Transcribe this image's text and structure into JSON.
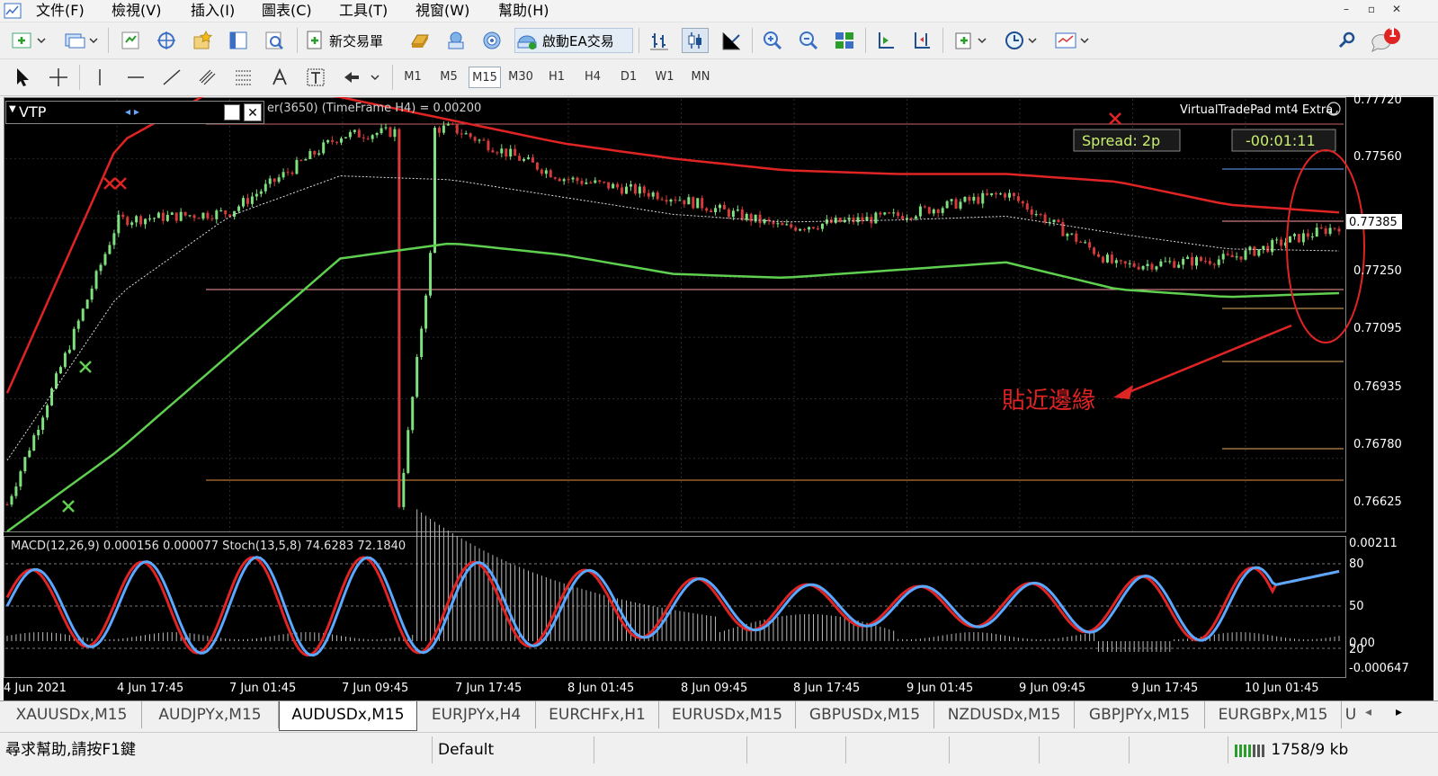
{
  "menu": {
    "file": "文件(F)",
    "view": "檢視(V)",
    "insert": "插入(I)",
    "charts": "圖表(C)",
    "tools": "工具(T)",
    "window": "視窗(W)",
    "help": "幫助(H)"
  },
  "toolbar": {
    "new_order": "新交易單",
    "start_ea": "啟動EA交易"
  },
  "timeframes": [
    "M1",
    "M5",
    "M15",
    "M30",
    "H1",
    "H4",
    "D1",
    "W1",
    "MN"
  ],
  "active_timeframe": "M15",
  "notification_count": "1",
  "vtp_panel": {
    "title": "VTP",
    "nav": "◂ ▸",
    "close": "✕"
  },
  "chart": {
    "indicator_label": "er(3650) (TimeFrame H4) = 0.00200",
    "vtp_brand": "VirtualTradePad mt4 Extra",
    "spread": "Spread: 2p",
    "timer": "-00:01:11",
    "annotation": "貼近邊緣",
    "current_price": "0.77385",
    "price_ticks": [
      "0.77720",
      "0.77560",
      "0.77250",
      "0.77095",
      "0.76935",
      "0.76780",
      "0.76625"
    ],
    "sub_label": "MACD(12,26,9) 0.000156 0.000077  Stoch(13,5,8) 74.6283 72.1840",
    "sub_ticks": [
      "0.00211",
      "80",
      "50",
      "0.00",
      "20",
      "-0.000647"
    ],
    "time_ticks": [
      "4 Jun 2021",
      "4 Jun 17:45",
      "7 Jun 01:45",
      "7 Jun 09:45",
      "7 Jun 17:45",
      "8 Jun 01:45",
      "8 Jun 09:45",
      "8 Jun 17:45",
      "9 Jun 01:45",
      "9 Jun 09:45",
      "9 Jun 17:45",
      "10 Jun 01:45"
    ]
  },
  "chart_tabs": [
    "XAUUSDx,M15",
    "AUDJPYx,M15",
    "AUDUSDx,M15",
    "EURJPYx,H4",
    "EURCHFx,H1",
    "EURUSDx,M15",
    "GBPUSDx,M15",
    "NZDUSDx,M15",
    "GBPJPYx,M15",
    "EURGBPx,M15",
    "U"
  ],
  "active_tab": "AUDUSDx,M15",
  "status": {
    "help": "尋求幫助,請按F1鍵",
    "profile": "Default",
    "traffic": "1758/9 kb"
  },
  "colors": {
    "upper_band": "#e02424",
    "lower_band": "#5fcf4f",
    "bull_candle": "#7ee07e",
    "bear_candle": "#d63b3b",
    "stoch_main": "#5aa8ff",
    "stoch_signal": "#e02424"
  },
  "icons": [
    "new-chart-icon",
    "profiles-icon",
    "market-watch-icon",
    "crosshair-icon",
    "favorites-icon",
    "data-window-icon",
    "strategy-tester-icon",
    "new-order-icon",
    "gold-icon",
    "news-icon",
    "signal-icon",
    "expert-advisor-icon",
    "bar-chart-icon",
    "candle-chart-icon",
    "line-chart-icon",
    "zoom-in-icon",
    "zoom-out-icon",
    "tile-icon",
    "autoscroll-icon",
    "chart-shift-icon",
    "indicators-icon",
    "periods-icon",
    "templates-icon",
    "search-icon",
    "notification-icon"
  ],
  "chart_data": {
    "type": "candlestick",
    "x": [
      "4 Jun 2021",
      "4 Jun 17:45",
      "7 Jun 01:45",
      "7 Jun 09:45",
      "7 Jun 17:45",
      "8 Jun 01:45",
      "8 Jun 09:45",
      "8 Jun 17:45",
      "9 Jun 01:45",
      "9 Jun 09:45",
      "9 Jun 17:45",
      "10 Jun 01:45"
    ],
    "ylim": [
      0.7659,
      0.7772
    ],
    "close": [
      0.7666,
      0.774,
      0.7742,
      0.7762,
      0.7764,
      0.7751,
      0.7746,
      0.7738,
      0.7741,
      0.7747,
      0.7728,
      0.773,
      0.77385
    ],
    "upper_band": [
      0.7695,
      0.776,
      0.7776,
      0.7772,
      0.7766,
      0.776,
      0.7756,
      0.7753,
      0.7752,
      0.7752,
      0.775,
      0.7744,
      0.7742
    ],
    "lower_band": [
      0.7659,
      0.768,
      0.7705,
      0.773,
      0.7734,
      0.7731,
      0.7726,
      0.7725,
      0.7727,
      0.7729,
      0.7722,
      0.772,
      0.7721
    ],
    "subwindow": {
      "macd": {
        "main": 0.000156,
        "signal": 7.7e-05
      },
      "stochastic": {
        "main": 74.6283,
        "signal": 72.184,
        "levels": [
          20,
          50,
          80
        ]
      }
    }
  }
}
